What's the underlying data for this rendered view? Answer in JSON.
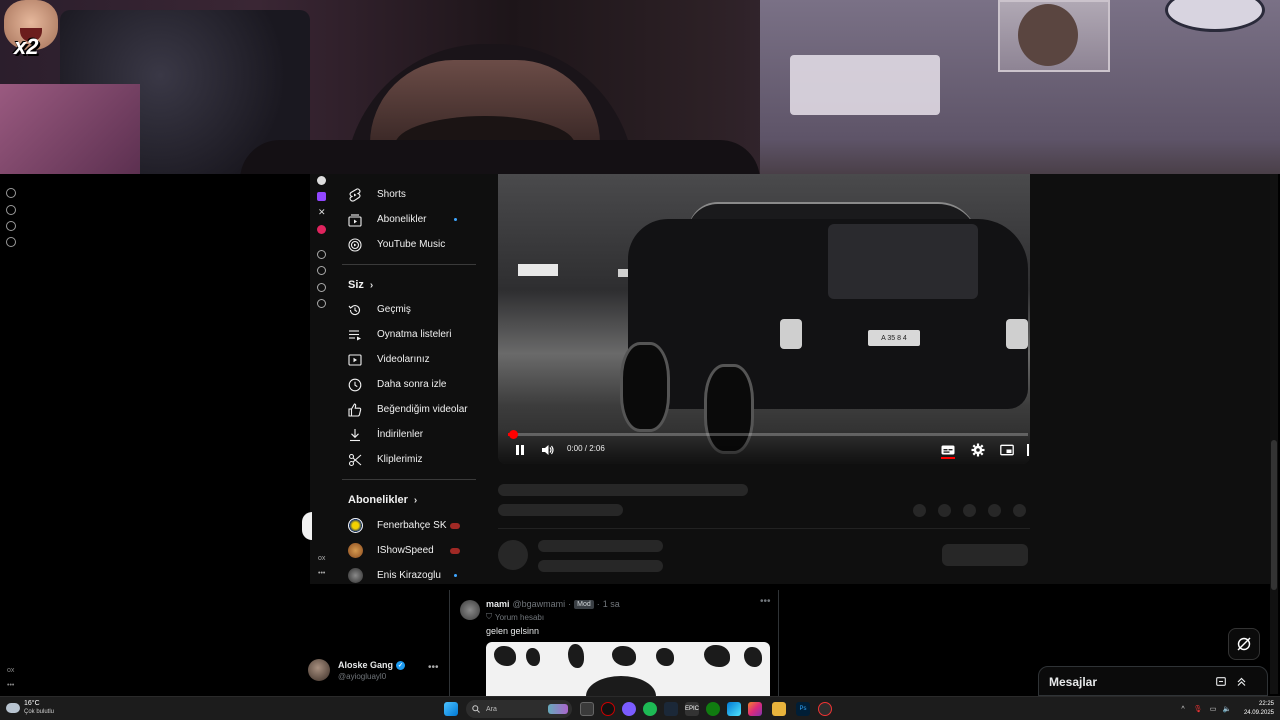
{
  "overlay": {
    "emote_text": "x2"
  },
  "youtube": {
    "nav_top": [
      {
        "label": "Shorts",
        "icon": "shorts-icon"
      },
      {
        "label": "Abonelikler",
        "icon": "subscriptions-icon"
      },
      {
        "label": "YouTube Music",
        "icon": "youtube-music-icon"
      }
    ],
    "section_you": "Siz",
    "nav_you": [
      {
        "label": "Geçmiş",
        "icon": "history-icon"
      },
      {
        "label": "Oynatma listeleri",
        "icon": "playlists-icon"
      },
      {
        "label": "Videolarınız",
        "icon": "your-videos-icon"
      },
      {
        "label": "Daha sonra izle",
        "icon": "watch-later-icon"
      },
      {
        "label": "Beğendiğim videolar",
        "icon": "liked-videos-icon"
      },
      {
        "label": "İndirilenler",
        "icon": "downloads-icon"
      },
      {
        "label": "Kliplerimiz",
        "icon": "clips-icon"
      }
    ],
    "section_subscriptions": "Abonelikler",
    "subscriptions": [
      {
        "label": "Fenerbahçe SK",
        "avatar_color": "#f5f5f5",
        "status": "live"
      },
      {
        "label": "IShowSpeed",
        "avatar_color": "#c0803a",
        "status": "live"
      },
      {
        "label": "Enis Kirazoglu",
        "avatar_color": "#5a5a5a",
        "status": "new"
      }
    ],
    "player": {
      "time": "0:00 / 2:06",
      "progress": 0.01,
      "plate": "A 35 8 4"
    },
    "accent": "#ff0000"
  },
  "tweet": {
    "name": "mami",
    "handle": "@bgawmami",
    "badge": "Mod",
    "time": "1 sa",
    "sub": "Yorum hesabı",
    "text": "gelen gelsinn"
  },
  "account": {
    "name": "Aloske Gang",
    "handle": "@ayiogluayl0"
  },
  "messages": {
    "title": "Mesajlar"
  },
  "corner": {
    "label_ox1": "ox",
    "label_ox2": "ox"
  },
  "taskbar": {
    "temp": "16°C",
    "weather": "Çok bulutlu",
    "search_placeholder": "Ara",
    "time": "22:25",
    "date": "24.09.2025"
  }
}
